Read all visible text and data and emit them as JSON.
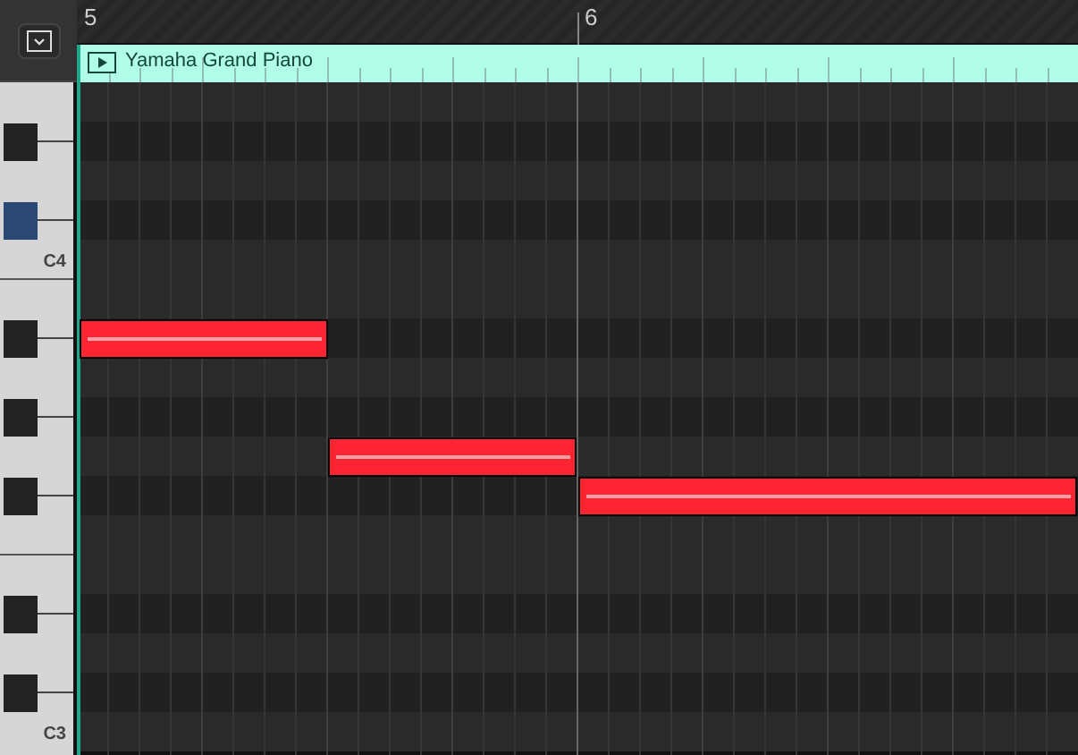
{
  "ruler": {
    "bars": [
      "5",
      "6"
    ]
  },
  "region": {
    "title": "Yamaha Grand Piano"
  },
  "keyboard": {
    "labels": [
      "C4",
      "C3"
    ]
  }
}
